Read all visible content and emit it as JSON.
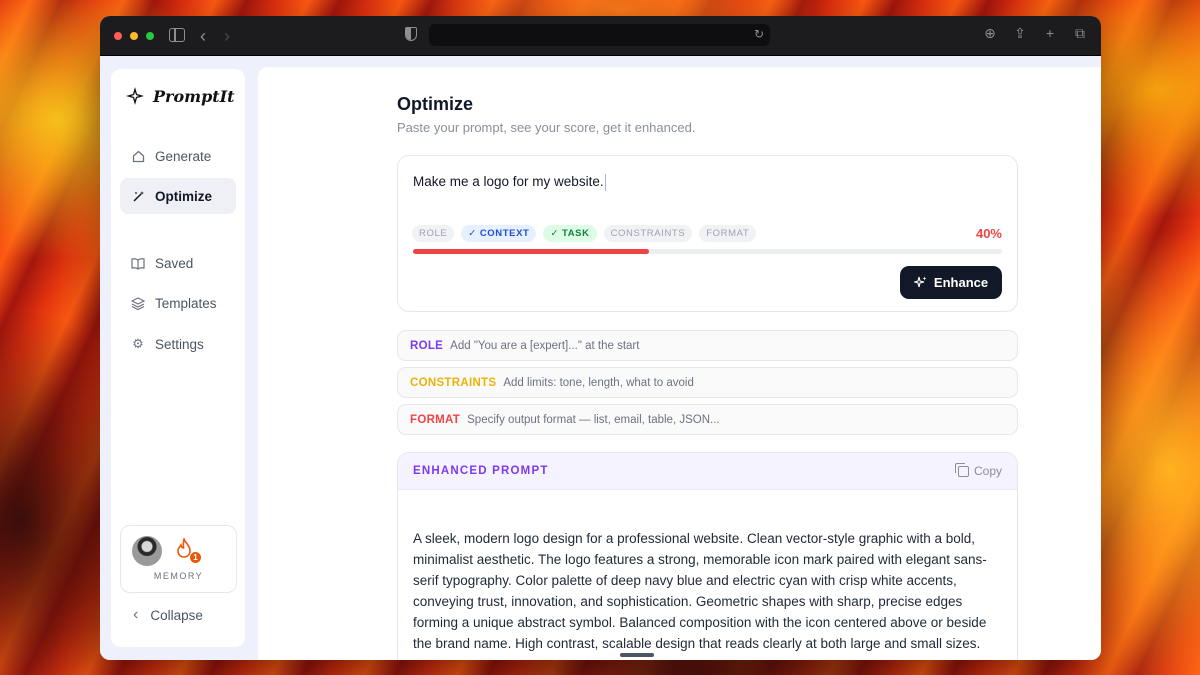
{
  "browser": {
    "url": ""
  },
  "sidebar": {
    "brand": "PromptIt",
    "items": [
      {
        "label": "Generate",
        "icon": "home-icon",
        "active": false
      },
      {
        "label": "Optimize",
        "icon": "magic-wand-icon",
        "active": true
      },
      {
        "label": "Saved",
        "icon": "book-icon",
        "active": false
      },
      {
        "label": "Templates",
        "icon": "layers-icon",
        "active": false
      },
      {
        "label": "Settings",
        "icon": "gear-icon",
        "active": false
      }
    ],
    "memory": {
      "label": "MEMORY",
      "streak_count": "1"
    },
    "collapse_label": "Collapse"
  },
  "main": {
    "title": "Optimize",
    "subtitle": "Paste your prompt, see your score, get it enhanced.",
    "prompt_text": "Make me a logo for my website.",
    "chips": [
      {
        "label": "ROLE",
        "checked": false
      },
      {
        "label": "CONTEXT",
        "checked": true,
        "color": "#1d4ed8"
      },
      {
        "label": "TASK",
        "checked": true,
        "color": "#15803d"
      },
      {
        "label": "CONSTRAINTS",
        "checked": false
      },
      {
        "label": "FORMAT",
        "checked": false
      }
    ],
    "check_mark": "✓",
    "score": "40%",
    "score_fraction": 0.4,
    "score_color": "#ef4444",
    "enhance_label": "Enhance",
    "hints": [
      {
        "tag": "ROLE",
        "text": "Add \"You are a [expert]...\" at the start",
        "color": "#7c3aed"
      },
      {
        "tag": "CONSTRAINTS",
        "text": "Add limits: tone, length, what to avoid",
        "color": "#eab308"
      },
      {
        "tag": "FORMAT",
        "text": "Specify output format — list, email, table, JSON...",
        "color": "#ef4444"
      }
    ],
    "enhanced": {
      "title": "ENHANCED PROMPT",
      "copy_label": "Copy",
      "body": "A sleek, modern logo design for a professional website. Clean vector-style graphic with a bold, minimalist aesthetic. The logo features a strong, memorable icon mark paired with elegant sans-serif typography. Color palette of deep navy blue and electric cyan with crisp white accents, conveying trust, innovation, and sophistication. Geometric shapes with sharp, precise edges forming a unique abstract symbol. Balanced composition with the icon centered above or beside the brand name. High contrast, scalable design that reads clearly at both large and small sizes."
    }
  },
  "colors": {
    "accent_dark": "#111827",
    "role_purple": "#7c3aed",
    "constraints_yellow": "#eab308",
    "format_red": "#ef4444"
  }
}
